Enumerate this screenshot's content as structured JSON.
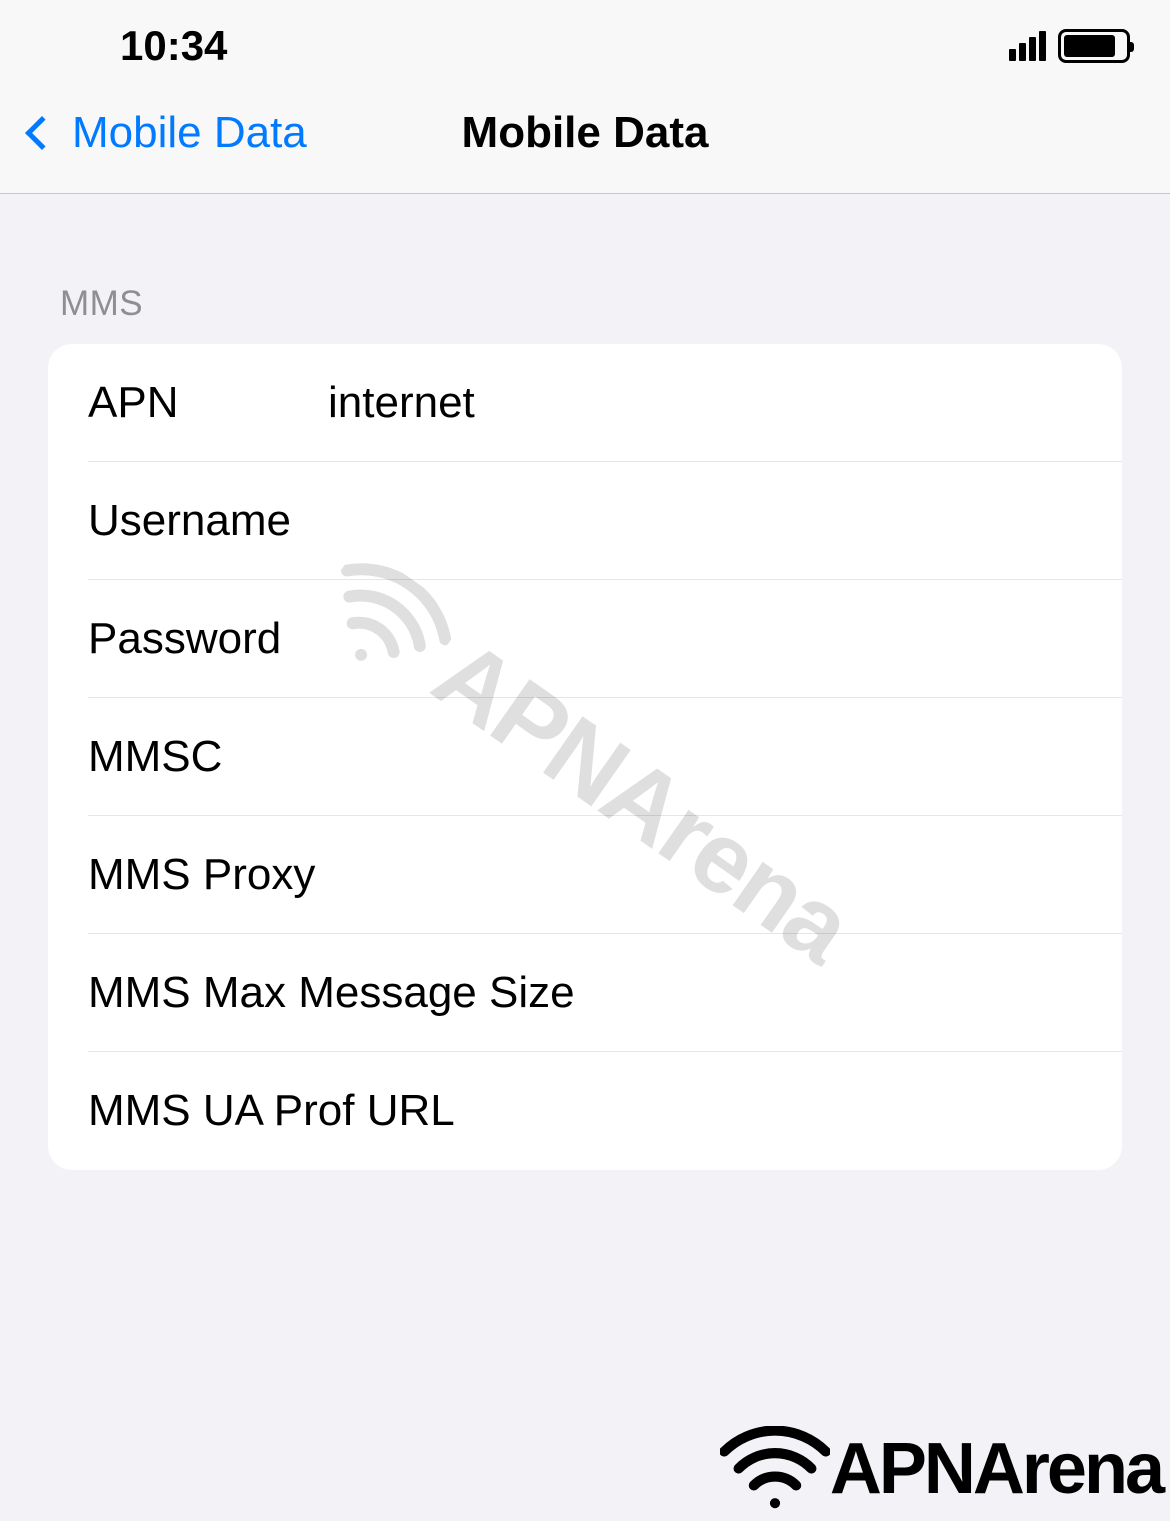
{
  "status_bar": {
    "time": "10:34"
  },
  "nav": {
    "back_label": "Mobile Data",
    "title": "Mobile Data"
  },
  "section": {
    "header": "MMS",
    "rows": [
      {
        "label": "APN",
        "value": "internet"
      },
      {
        "label": "Username",
        "value": ""
      },
      {
        "label": "Password",
        "value": ""
      },
      {
        "label": "MMSC",
        "value": ""
      },
      {
        "label": "MMS Proxy",
        "value": ""
      },
      {
        "label": "MMS Max Message Size",
        "value": ""
      },
      {
        "label": "MMS UA Prof URL",
        "value": ""
      }
    ]
  },
  "watermark": {
    "text": "APNArena"
  },
  "brand_footer": {
    "text": "APNArena"
  }
}
